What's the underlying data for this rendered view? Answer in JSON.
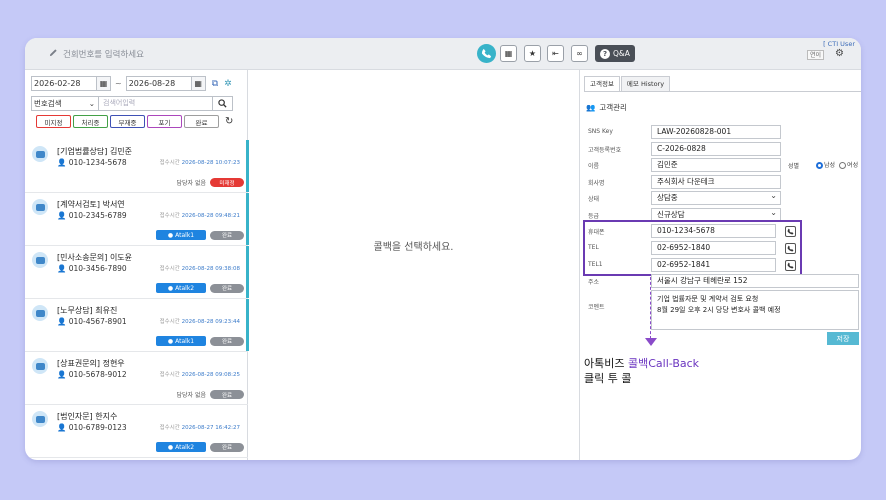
{
  "topbar": {
    "search_placeholder": "건회번호를 입력하세요",
    "qa_label": "Q&A",
    "cti_user": "[ CTI User",
    "user_label": "연이"
  },
  "filters": {
    "date_from": "2026-02-28",
    "date_to": "2026-08-28",
    "tilde": "~",
    "search_type": "번호검색",
    "keyword_placeholder": "검색어입력",
    "status_buttons": [
      {
        "label": "미지정",
        "color": "#e53935"
      },
      {
        "label": "처리중",
        "color": "#43a047"
      },
      {
        "label": "부재중",
        "color": "#3f51b5"
      },
      {
        "label": "포기",
        "color": "#ab47bc"
      },
      {
        "label": "완료",
        "color": "#9e9e9e"
      }
    ]
  },
  "callbacks": [
    {
      "title": "[기업법률상담] 김민준",
      "phone": "010-1234-5678",
      "time_label": "접수시간",
      "time": "2026-08-28 10:07:23",
      "manager": "담당자 없음",
      "status": "미재정",
      "atalk": ""
    },
    {
      "title": "[계약서검토] 박서연",
      "phone": "010-2345-6789",
      "time_label": "접수시간",
      "time": "2026-08-28 09:48:21",
      "manager": "",
      "status": "완료",
      "atalk": "Atalk1"
    },
    {
      "title": "[민사소송문의] 이도윤",
      "phone": "010-3456-7890",
      "time_label": "접수시간",
      "time": "2026-08-28 09:38:08",
      "manager": "",
      "status": "완료",
      "atalk": "Atalk2"
    },
    {
      "title": "[노무상담] 최유진",
      "phone": "010-4567-8901",
      "time_label": "접수시간",
      "time": "2026-08-28 09:23:44",
      "manager": "",
      "status": "완료",
      "atalk": "Atalk1"
    },
    {
      "title": "[상표권문의] 정현우",
      "phone": "010-5678-9012",
      "time_label": "접수시간",
      "time": "2026-08-28 09:08:25",
      "manager": "담당자 없음",
      "status": "완료",
      "atalk": ""
    },
    {
      "title": "[법인자문] 한지수",
      "phone": "010-6789-0123",
      "time_label": "접수시간",
      "time": "2026-08-27 16:42:27",
      "manager": "",
      "status": "완료",
      "atalk": "Atalk2"
    }
  ],
  "center": {
    "message": "콜백을 선택하세요."
  },
  "customer": {
    "tabs": [
      "고객정보",
      "메모 History"
    ],
    "section_title": "고객관리",
    "fields": {
      "sns_key": {
        "label": "SNS Key",
        "value": "LAW-20260828-001"
      },
      "cust_no": {
        "label": "고객등록번호",
        "value": "C-2026-0828"
      },
      "name": {
        "label": "이름",
        "value": "김민준"
      },
      "company": {
        "label": "회사명",
        "value": "주식회사 다운테크"
      },
      "state": {
        "label": "상태",
        "value": "상담중"
      },
      "grade": {
        "label": "등급",
        "value": "신규상담"
      },
      "mobile": {
        "label": "휴대폰",
        "value": "010-1234-5678"
      },
      "tel": {
        "label": "TEL",
        "value": "02-6952-1840"
      },
      "tel1": {
        "label": "TEL1",
        "value": "02-6952-1841"
      },
      "address": {
        "label": "주소",
        "value": "서울시 강남구 테헤란로 152"
      },
      "comment": {
        "label": "코멘트",
        "line1": "기업 법률자문 및 계약서 검토 요청",
        "line2": "8월 29일 오후 2시 당당 변호사 콜백 예정"
      }
    },
    "gender_label": "성별",
    "gender_male": "남성",
    "gender_female": "여성",
    "save_label": "저장"
  },
  "annotation": {
    "line1_prefix": "아톡비즈 ",
    "line1_highlight": "콜백Call-Back",
    "line2": "클릭 투 콜",
    "highlight_color": "#6b35c0"
  }
}
